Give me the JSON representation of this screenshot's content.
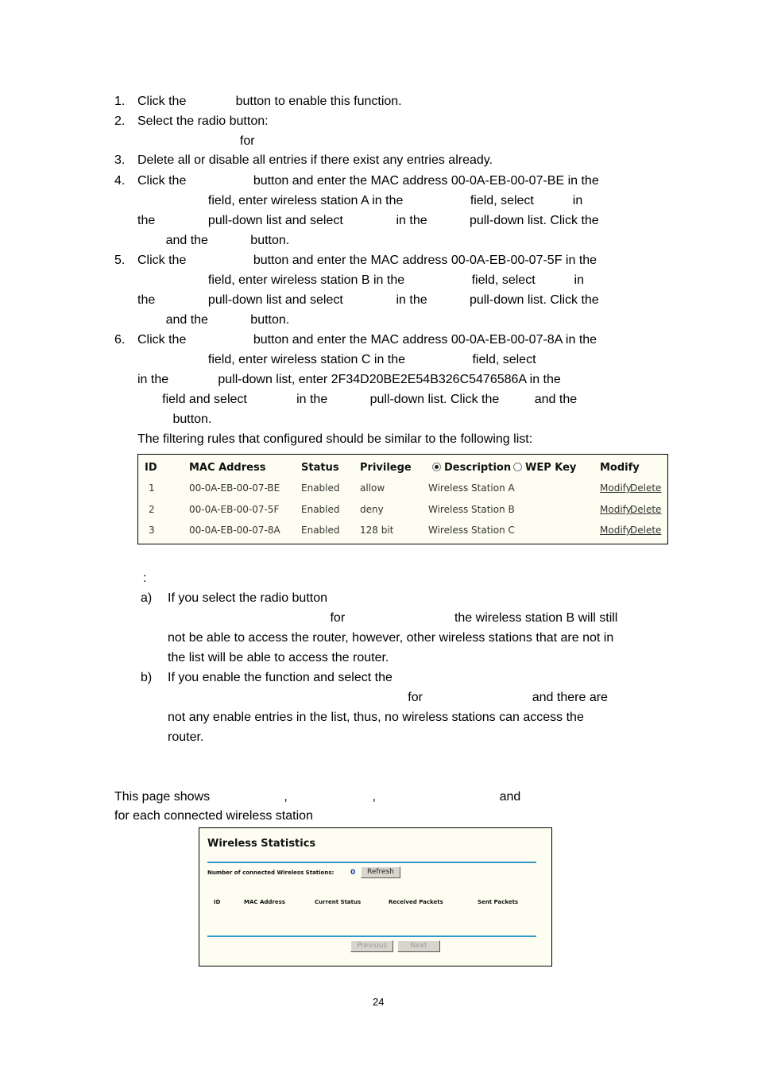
{
  "steps": [
    {
      "num": "1.",
      "lines": [
        "Click the              button to enable this function."
      ]
    },
    {
      "num": "2.",
      "lines": [
        "Select the radio button:",
        "                             for"
      ]
    },
    {
      "num": "3.",
      "lines": [
        "Delete all or disable all entries if there exist any entries already."
      ]
    },
    {
      "num": "4.",
      "lines": [
        "Click the                   button and enter the MAC address 00-0A-EB-00-07-BE in the",
        "                    field, enter wireless station A in the                   field, select           in",
        "the               pull-down list and select               in the            pull-down list. Click the",
        "        and the            button."
      ]
    },
    {
      "num": "5.",
      "lines": [
        "Click the                   button and enter the MAC address 00-0A-EB-00-07-5F in the",
        "                    field, enter wireless station B in the                   field, select           in",
        "the               pull-down list and select               in the            pull-down list. Click the",
        "        and the            button."
      ]
    },
    {
      "num": "6.",
      "lines": [
        "Click the                   button and enter the MAC address 00-0A-EB-00-07-8A in the",
        "                    field, enter wireless station C in the                   field, select",
        "in the              pull-down list, enter 2F34D20BE2E54B326C5476586A in the",
        "       field and select              in the            pull-down list. Click the          and the",
        "          button."
      ]
    }
  ],
  "filter_intro": "The filtering rules that configured should be similar to the following list:",
  "filter_table": {
    "headers": {
      "id": "ID",
      "mac": "MAC Address",
      "status": "Status",
      "privilege": "Privilege",
      "description": "Description",
      "wep_key": "WEP Key",
      "modify": "Modify"
    },
    "description_radio_selected": true,
    "wep_key_radio_selected": false,
    "rows": [
      {
        "id": "1",
        "mac": "00-0A-EB-00-07-BE",
        "status": "Enabled",
        "privilege": "allow",
        "description": "Wireless Station A",
        "modify": "Modify",
        "delete": "Delete"
      },
      {
        "id": "2",
        "mac": "00-0A-EB-00-07-5F",
        "status": "Enabled",
        "privilege": "deny",
        "description": "Wireless Station B",
        "modify": "Modify",
        "delete": "Delete"
      },
      {
        "id": "3",
        "mac": "00-0A-EB-00-07-8A",
        "status": "Enabled",
        "privilege": "128 bit",
        "description": "Wireless Station C",
        "modify": "Modify",
        "delete": "Delete"
      }
    ]
  },
  "note": {
    "colon": ":",
    "items": [
      {
        "label": "a)",
        "lines": [
          "If you select the radio button",
          "                                              for                               the wireless station B will still",
          "not be able to access the router, however, other wireless stations that are not in",
          "the list will be able to access the router."
        ]
      },
      {
        "label": "b)",
        "lines": [
          "If you enable the function and select the",
          "                                                                    for                               and there are",
          "not any enable entries in the list, thus, no wireless stations can access the",
          "router."
        ]
      }
    ]
  },
  "stats_intro": {
    "line1": "This page shows                     ,                        ,                                   and",
    "line2": "for each connected wireless station"
  },
  "wireless_stats": {
    "title": "Wireless Statistics",
    "count_label": "Number of connected Wireless Stations:",
    "count_value": "0",
    "refresh_label": "Refresh",
    "columns": [
      "ID",
      "MAC Address",
      "Current Status",
      "Received Packets",
      "Sent Packets"
    ],
    "previous_label": "Previous",
    "next_label": "Next"
  },
  "page_number": "24"
}
